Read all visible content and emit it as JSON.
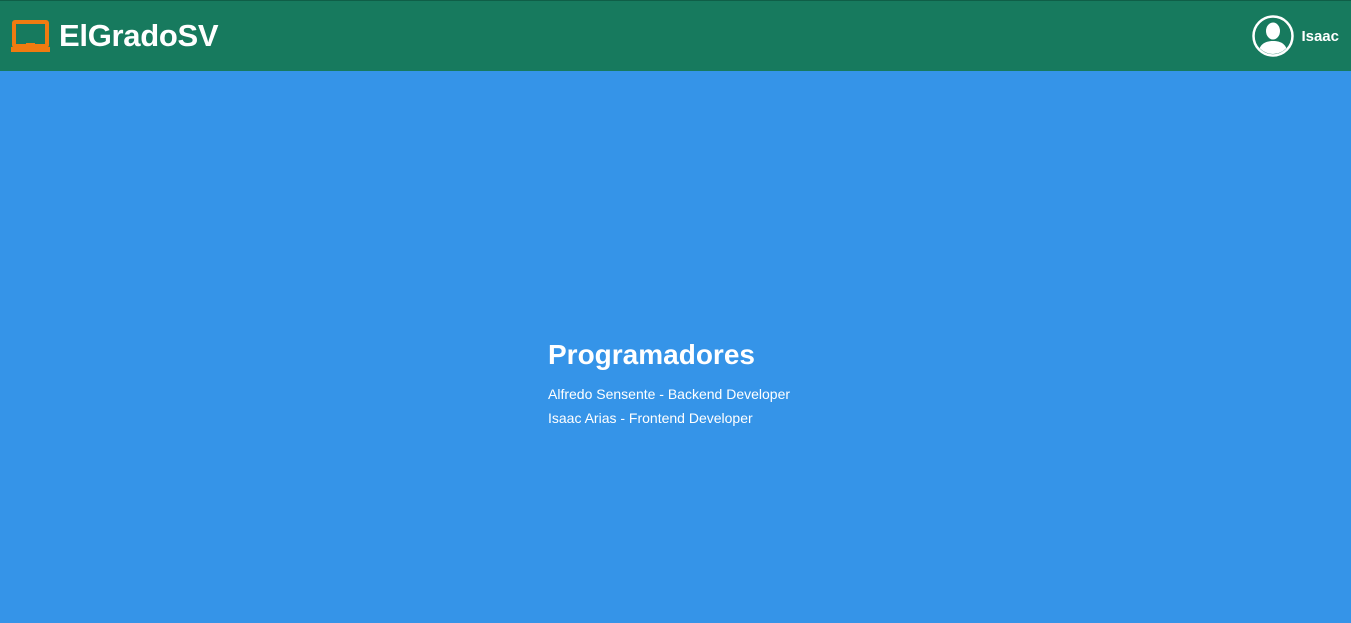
{
  "header": {
    "brand_name": "ElGradoSV",
    "brand_icon": "laptop-icon",
    "user_name": "Isaac",
    "avatar_icon": "user-avatar-icon",
    "colors": {
      "header_bg": "#177a5e",
      "brand_icon": "#f07b10"
    }
  },
  "main": {
    "heading": "Programadores",
    "developers": [
      "Alfredo Sensente - Backend Developer",
      "Isaac Arias - Frontend Developer"
    ],
    "background_color": "#3594e8"
  }
}
